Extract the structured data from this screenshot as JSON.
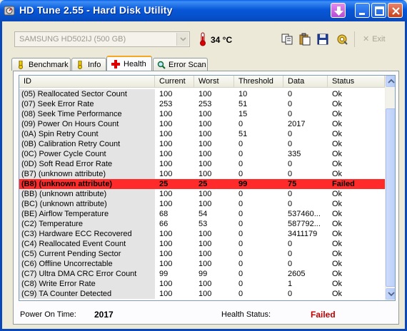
{
  "window": {
    "title": "HD Tune 2.55 - Hard Disk Utility"
  },
  "toolbar": {
    "drive": "SAMSUNG HD502IJ (500 GB)",
    "temperature": "34 °C",
    "exit_label": "Exit"
  },
  "tabs": [
    {
      "label": "Benchmark",
      "icon": "benchmark-icon"
    },
    {
      "label": "Info",
      "icon": "info-icon"
    },
    {
      "label": "Health",
      "icon": "health-cross-icon",
      "active": true
    },
    {
      "label": "Error Scan",
      "icon": "magnifier-icon"
    }
  ],
  "table": {
    "columns": [
      "ID",
      "Current",
      "Worst",
      "Threshold",
      "Data",
      "Status"
    ],
    "rows": [
      [
        "(05) Reallocated Sector Count",
        "100",
        "100",
        "10",
        "0",
        "Ok"
      ],
      [
        "(07) Seek Error Rate",
        "253",
        "253",
        "51",
        "0",
        "Ok"
      ],
      [
        "(08) Seek Time Performance",
        "100",
        "100",
        "15",
        "0",
        "Ok"
      ],
      [
        "(09) Power On Hours Count",
        "100",
        "100",
        "0",
        "2017",
        "Ok"
      ],
      [
        "(0A) Spin Retry Count",
        "100",
        "100",
        "51",
        "0",
        "Ok"
      ],
      [
        "(0B) Calibration Retry Count",
        "100",
        "100",
        "0",
        "0",
        "Ok"
      ],
      [
        "(0C) Power Cycle Count",
        "100",
        "100",
        "0",
        "335",
        "Ok"
      ],
      [
        "(0D) Soft Read Error Rate",
        "100",
        "100",
        "0",
        "0",
        "Ok"
      ],
      [
        "(B7) (unknown attribute)",
        "100",
        "100",
        "0",
        "0",
        "Ok"
      ],
      [
        "(B8) (unknown attribute)",
        "25",
        "25",
        "99",
        "75",
        "Failed"
      ],
      [
        "(BB) (unknown attribute)",
        "100",
        "100",
        "0",
        "0",
        "Ok"
      ],
      [
        "(BC) (unknown attribute)",
        "100",
        "100",
        "0",
        "0",
        "Ok"
      ],
      [
        "(BE) Airflow Temperature",
        "68",
        "54",
        "0",
        "537460...",
        "Ok"
      ],
      [
        "(C2) Temperature",
        "66",
        "53",
        "0",
        "587792...",
        "Ok"
      ],
      [
        "(C3) Hardware ECC Recovered",
        "100",
        "100",
        "0",
        "3411179",
        "Ok"
      ],
      [
        "(C4) Reallocated Event Count",
        "100",
        "100",
        "0",
        "0",
        "Ok"
      ],
      [
        "(C5) Current Pending Sector",
        "100",
        "100",
        "0",
        "0",
        "Ok"
      ],
      [
        "(C6) Offline Uncorrectable",
        "100",
        "100",
        "0",
        "0",
        "Ok"
      ],
      [
        "(C7) Ultra DMA CRC Error Count",
        "99",
        "99",
        "0",
        "2605",
        "Ok"
      ],
      [
        "(C8) Write Error Rate",
        "100",
        "100",
        "0",
        "1",
        "Ok"
      ],
      [
        "(C9) TA Counter Detected",
        "100",
        "100",
        "0",
        "0",
        "Ok"
      ]
    ],
    "failed_row_color": "#ff2a2a"
  },
  "footer": {
    "power_on_label": "Power On Time:",
    "power_on_value": "2017",
    "health_label": "Health Status:",
    "health_value": "Failed",
    "health_color": "#c00000"
  }
}
